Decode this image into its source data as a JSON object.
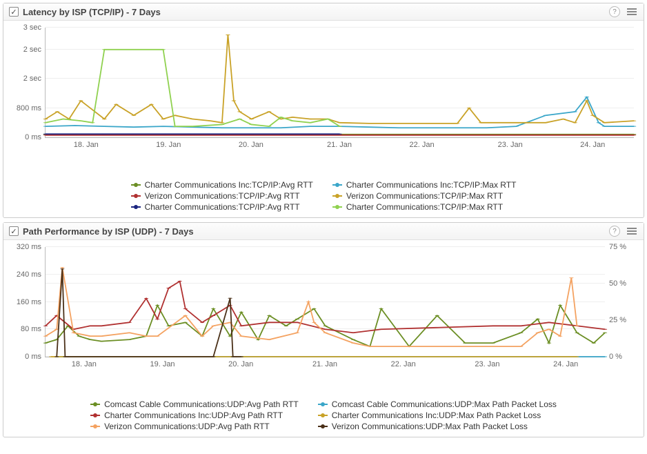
{
  "panels": [
    {
      "title": "Latency by ISP (TCP/IP) - 7 Days",
      "y_ticks": [
        "0 ms",
        "800 ms",
        "2 sec",
        "2 sec",
        "3 sec"
      ],
      "x_ticks": [
        "18. Jan",
        "19. Jan",
        "20. Jan",
        "21. Jan",
        "22. Jan",
        "23. Jan",
        "24. Jan"
      ],
      "legend_left": [
        {
          "label": "Charter Communications Inc:TCP/IP:Avg RTT",
          "color": "#6b8e23"
        },
        {
          "label": "Verizon Communications:TCP/IP:Avg RTT",
          "color": "#b03030"
        },
        {
          "label": "Charter Communications:TCP/IP:Avg RTT",
          "color": "#1a237e"
        }
      ],
      "legend_right": [
        {
          "label": "Charter Communications Inc:TCP/IP:Max RTT",
          "color": "#3aa6c9"
        },
        {
          "label": "Verizon Communications:TCP/IP:Max RTT",
          "color": "#c9a227"
        },
        {
          "label": "Charter Communications:TCP/IP:Max RTT",
          "color": "#8fd14f"
        }
      ]
    },
    {
      "title": "Path Performance by ISP (UDP) - 7 Days",
      "y_ticks": [
        "0 ms",
        "80 ms",
        "160 ms",
        "240 ms",
        "320 ms"
      ],
      "y2_ticks": [
        "0 %",
        "25 %",
        "50 %",
        "75 %"
      ],
      "x_ticks": [
        "18. Jan",
        "19. Jan",
        "20. Jan",
        "21. Jan",
        "22. Jan",
        "23. Jan",
        "24. Jan"
      ],
      "legend_left": [
        {
          "label": "Comcast Cable Communications:UDP:Avg Path RTT",
          "color": "#6b8e23"
        },
        {
          "label": "Charter Communications Inc:UDP:Avg Path RTT",
          "color": "#b03030"
        },
        {
          "label": "Verizon Communications:UDP:Avg Path RTT",
          "color": "#f4a261"
        }
      ],
      "legend_right": [
        {
          "label": "Comcast Cable Communications:UDP:Max Path Packet Loss",
          "color": "#3aa6c9"
        },
        {
          "label": "Charter Communications Inc:UDP:Max Path Packet Loss",
          "color": "#c9a227"
        },
        {
          "label": "Verizon Communications:UDP:Max Path Packet Loss",
          "color": "#4a3018"
        }
      ]
    }
  ],
  "chart_data": [
    {
      "type": "line",
      "title": "Latency by ISP (TCP/IP) - 7 Days",
      "xlabel": "",
      "ylabel": "",
      "x_categories": [
        "18. Jan",
        "19. Jan",
        "20. Jan",
        "21. Jan",
        "22. Jan",
        "23. Jan",
        "24. Jan"
      ],
      "ylim_ms": [
        0,
        3000
      ],
      "series": [
        {
          "name": "Charter Communications Inc:TCP/IP:Avg RTT",
          "color": "#6b8e23",
          "unit": "ms",
          "x": [
            0,
            0.05,
            0.1,
            0.15,
            0.2,
            0.25,
            0.3,
            0.35,
            0.4,
            0.45,
            0.5,
            0.55,
            0.6,
            0.65,
            0.7,
            0.75,
            0.8,
            0.85,
            0.9,
            0.95,
            1.0
          ],
          "values": [
            80,
            80,
            80,
            80,
            80,
            80,
            80,
            80,
            80,
            80,
            80,
            80,
            80,
            80,
            80,
            80,
            80,
            80,
            80,
            80,
            80
          ]
        },
        {
          "name": "Charter Communications Inc:TCP/IP:Max RTT",
          "color": "#3aa6c9",
          "unit": "ms",
          "x": [
            0,
            0.05,
            0.1,
            0.15,
            0.2,
            0.25,
            0.3,
            0.35,
            0.4,
            0.45,
            0.5,
            0.55,
            0.6,
            0.65,
            0.7,
            0.75,
            0.8,
            0.85,
            0.9,
            0.92,
            0.94,
            0.95,
            1.0
          ],
          "values": [
            300,
            320,
            300,
            280,
            300,
            280,
            260,
            260,
            260,
            300,
            300,
            280,
            260,
            260,
            260,
            260,
            300,
            600,
            700,
            1100,
            400,
            300,
            300
          ]
        },
        {
          "name": "Verizon Communications:TCP/IP:Avg RTT",
          "color": "#b03030",
          "unit": "ms",
          "x": [
            0,
            0.05,
            0.1,
            0.15,
            0.2,
            0.25,
            0.3,
            0.35,
            0.4,
            0.45,
            0.5,
            0.55,
            0.6,
            0.65,
            0.7,
            0.75,
            0.8,
            0.85,
            0.9,
            0.95,
            1.0
          ],
          "values": [
            60,
            60,
            60,
            60,
            60,
            60,
            60,
            60,
            60,
            60,
            60,
            60,
            60,
            60,
            60,
            60,
            60,
            60,
            60,
            60,
            60
          ]
        },
        {
          "name": "Verizon Communications:TCP/IP:Max RTT",
          "color": "#c9a227",
          "unit": "ms",
          "x": [
            0,
            0.02,
            0.04,
            0.06,
            0.1,
            0.12,
            0.15,
            0.18,
            0.2,
            0.22,
            0.25,
            0.28,
            0.3,
            0.31,
            0.32,
            0.33,
            0.35,
            0.38,
            0.4,
            0.42,
            0.45,
            0.48,
            0.5,
            0.55,
            0.6,
            0.65,
            0.7,
            0.72,
            0.74,
            0.8,
            0.85,
            0.88,
            0.9,
            0.92,
            0.93,
            0.95,
            1.0
          ],
          "values": [
            500,
            700,
            500,
            1000,
            500,
            900,
            600,
            900,
            500,
            600,
            500,
            450,
            400,
            2800,
            1000,
            700,
            500,
            700,
            500,
            550,
            500,
            500,
            400,
            380,
            380,
            380,
            380,
            800,
            400,
            400,
            400,
            500,
            400,
            1000,
            600,
            400,
            450
          ]
        },
        {
          "name": "Charter Communications:TCP/IP:Avg RTT",
          "color": "#1a237e",
          "unit": "ms",
          "x": [
            0,
            0.05,
            0.1,
            0.15,
            0.2,
            0.25,
            0.3,
            0.35,
            0.4,
            0.45,
            0.5
          ],
          "values": [
            90,
            90,
            90,
            90,
            90,
            90,
            90,
            90,
            90,
            90,
            90
          ]
        },
        {
          "name": "Charter Communications:TCP/IP:Max RTT",
          "color": "#8fd14f",
          "unit": "ms",
          "x": [
            0,
            0.03,
            0.06,
            0.08,
            0.1,
            0.15,
            0.2,
            0.22,
            0.25,
            0.3,
            0.33,
            0.35,
            0.38,
            0.4,
            0.42,
            0.45,
            0.48,
            0.5
          ],
          "values": [
            400,
            500,
            450,
            400,
            2400,
            2400,
            2400,
            300,
            300,
            350,
            500,
            350,
            300,
            550,
            450,
            400,
            500,
            300
          ]
        }
      ]
    },
    {
      "type": "line",
      "title": "Path Performance by ISP (UDP) - 7 Days",
      "xlabel": "",
      "ylabel": "",
      "x_categories": [
        "18. Jan",
        "19. Jan",
        "20. Jan",
        "21. Jan",
        "22. Jan",
        "23. Jan",
        "24. Jan"
      ],
      "ylim_ms": [
        0,
        320
      ],
      "y2lim_pct": [
        0,
        75
      ],
      "series": [
        {
          "name": "Comcast Cable Communications:UDP:Avg Path RTT",
          "color": "#6b8e23",
          "unit": "ms",
          "axis": "left",
          "x": [
            0,
            0.02,
            0.04,
            0.06,
            0.08,
            0.1,
            0.15,
            0.18,
            0.2,
            0.22,
            0.25,
            0.28,
            0.3,
            0.33,
            0.35,
            0.38,
            0.4,
            0.43,
            0.45,
            0.48,
            0.5,
            0.55,
            0.58,
            0.6,
            0.65,
            0.7,
            0.75,
            0.8,
            0.85,
            0.88,
            0.9,
            0.92,
            0.95,
            0.98,
            1.0
          ],
          "values": [
            40,
            50,
            90,
            60,
            50,
            45,
            50,
            60,
            150,
            90,
            100,
            60,
            140,
            60,
            130,
            50,
            120,
            90,
            110,
            140,
            90,
            50,
            30,
            140,
            30,
            120,
            40,
            40,
            70,
            110,
            40,
            150,
            70,
            40,
            70
          ]
        },
        {
          "name": "Charter Communications Inc:UDP:Avg Path RTT",
          "color": "#b03030",
          "unit": "ms",
          "axis": "left",
          "x": [
            0,
            0.02,
            0.05,
            0.08,
            0.1,
            0.15,
            0.18,
            0.2,
            0.22,
            0.24,
            0.25,
            0.28,
            0.3,
            0.33,
            0.35,
            0.4,
            0.45,
            0.5,
            0.55,
            0.6,
            0.8,
            0.85,
            0.9,
            0.95,
            1.0
          ],
          "values": [
            90,
            120,
            80,
            90,
            90,
            100,
            170,
            110,
            200,
            220,
            140,
            100,
            120,
            150,
            90,
            100,
            100,
            80,
            70,
            80,
            90,
            90,
            100,
            90,
            80
          ]
        },
        {
          "name": "Verizon Communications:UDP:Avg Path RTT",
          "color": "#f4a261",
          "unit": "ms",
          "axis": "left",
          "x": [
            0,
            0.02,
            0.03,
            0.05,
            0.08,
            0.1,
            0.15,
            0.18,
            0.2,
            0.25,
            0.28,
            0.3,
            0.33,
            0.35,
            0.4,
            0.45,
            0.47,
            0.48,
            0.5,
            0.55,
            0.58,
            0.6,
            0.85,
            0.88,
            0.9,
            0.92,
            0.94,
            0.95
          ],
          "values": [
            60,
            80,
            260,
            70,
            60,
            60,
            70,
            60,
            60,
            120,
            60,
            90,
            100,
            60,
            50,
            70,
            160,
            100,
            70,
            40,
            30,
            30,
            30,
            70,
            80,
            60,
            230,
            90
          ]
        },
        {
          "name": "Comcast Cable Communications:UDP:Max Path Packet Loss",
          "color": "#3aa6c9",
          "unit": "%",
          "axis": "right",
          "x": [
            0.02,
            0.06,
            0.12,
            0.2,
            0.3,
            0.38,
            0.42,
            0.5,
            0.6,
            0.7,
            0.8,
            0.9,
            1.0
          ],
          "values": [
            0,
            0,
            0,
            0,
            0,
            0,
            0,
            0,
            0,
            0,
            0,
            0,
            0
          ]
        },
        {
          "name": "Charter Communications Inc:UDP:Max Path Packet Loss",
          "color": "#c9a227",
          "unit": "%",
          "axis": "right",
          "x": [
            0.01,
            0.05,
            0.1,
            0.15,
            0.2,
            0.25,
            0.3,
            0.35,
            0.4,
            0.45,
            0.5,
            0.55,
            0.85,
            0.9,
            0.95
          ],
          "values": [
            0,
            0,
            0,
            0,
            0,
            0,
            0,
            0,
            0,
            0,
            0,
            0,
            0,
            0,
            0
          ]
        },
        {
          "name": "Verizon Communications:UDP:Max Path Packet Loss",
          "color": "#4a3018",
          "unit": "%",
          "axis": "right",
          "x": [
            0.02,
            0.03,
            0.035,
            0.04,
            0.3,
            0.33,
            0.335,
            0.34,
            0.35
          ],
          "values": [
            0,
            60,
            0,
            0,
            0,
            40,
            0,
            0,
            0
          ]
        }
      ]
    }
  ]
}
